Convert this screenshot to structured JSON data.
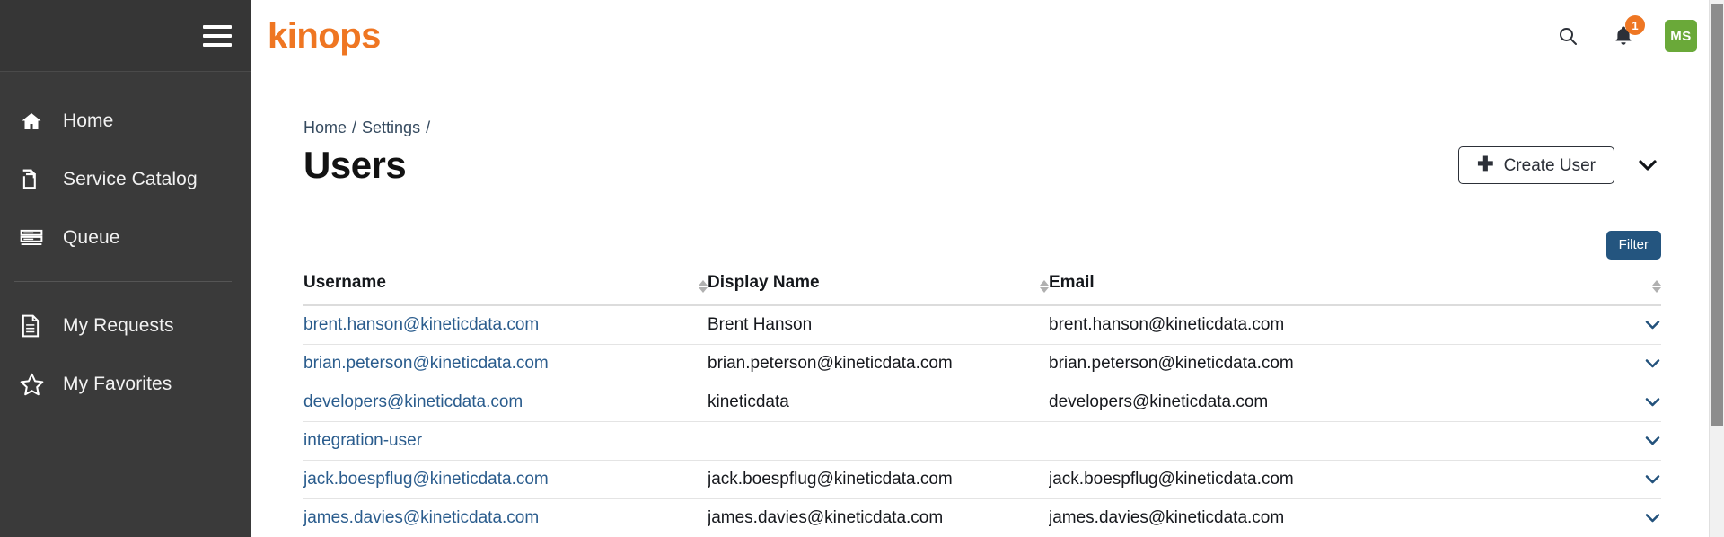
{
  "brand": {
    "name": "kinops",
    "color": "#ef7622"
  },
  "sidebar": {
    "hamburger_icon": "hamburger-menu-icon",
    "items": [
      {
        "label": "Home",
        "icon": "home-icon"
      },
      {
        "label": "Service Catalog",
        "icon": "copy-documents-icon"
      },
      {
        "label": "Queue",
        "icon": "list-lines-icon"
      },
      {
        "label": "My Requests",
        "icon": "document-icon"
      },
      {
        "label": "My Favorites",
        "icon": "star-icon"
      }
    ]
  },
  "topbar": {
    "search_icon": "search-icon",
    "notifications_icon": "bell-icon",
    "notifications_count": "1",
    "avatar_initials": "MS",
    "avatar_color": "#6aa939",
    "badge_color": "#ee7623"
  },
  "breadcrumb": {
    "items": [
      "Home",
      "Settings"
    ],
    "separator": "/",
    "trailing_separator": "/"
  },
  "page": {
    "title": "Users",
    "create_button_label": "Create User",
    "create_button_icon": "plus-icon",
    "more_actions_icon": "chevron-down-icon"
  },
  "filter": {
    "label": "Filter",
    "color": "#24557f"
  },
  "table": {
    "columns": [
      {
        "key": "username",
        "label": "Username",
        "sortable": true
      },
      {
        "key": "display_name",
        "label": "Display Name",
        "sortable": true
      },
      {
        "key": "email",
        "label": "Email",
        "sortable": true
      }
    ],
    "row_action_icon": "chevron-down-icon",
    "rows": [
      {
        "username": "brent.hanson@kineticdata.com",
        "display_name": "Brent Hanson",
        "email": "brent.hanson@kineticdata.com"
      },
      {
        "username": "brian.peterson@kineticdata.com",
        "display_name": "brian.peterson@kineticdata.com",
        "email": "brian.peterson@kineticdata.com"
      },
      {
        "username": "developers@kineticdata.com",
        "display_name": "kineticdata",
        "email": "developers@kineticdata.com"
      },
      {
        "username": "integration-user",
        "display_name": "",
        "email": ""
      },
      {
        "username": "jack.boespflug@kineticdata.com",
        "display_name": "jack.boespflug@kineticdata.com",
        "email": "jack.boespflug@kineticdata.com"
      },
      {
        "username": "james.davies@kineticdata.com",
        "display_name": "james.davies@kineticdata.com",
        "email": "james.davies@kineticdata.com"
      }
    ]
  }
}
